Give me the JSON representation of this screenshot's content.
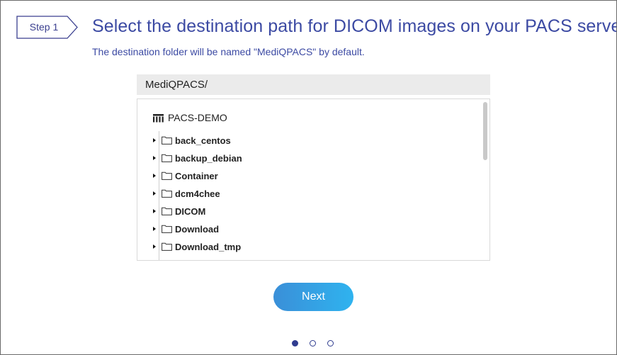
{
  "step": {
    "label": "Step 1"
  },
  "header": {
    "title": "Select the destination path for DICOM images on your PACS server.",
    "subtitle": "The destination folder will be named \"MediQPACS\" by default."
  },
  "path_bar": {
    "value": "MediQPACS/"
  },
  "tree": {
    "root": {
      "label": "PACS-DEMO",
      "icon": "server-icon"
    },
    "items": [
      {
        "label": "back_centos",
        "icon": "folder-icon"
      },
      {
        "label": "backup_debian",
        "icon": "folder-icon"
      },
      {
        "label": "Container",
        "icon": "folder-icon"
      },
      {
        "label": "dcm4chee",
        "icon": "folder-icon"
      },
      {
        "label": "DICOM",
        "icon": "folder-icon"
      },
      {
        "label": "Download",
        "icon": "folder-icon"
      },
      {
        "label": "Download_tmp",
        "icon": "folder-icon"
      }
    ]
  },
  "actions": {
    "next_label": "Next"
  },
  "pager": {
    "current": 1,
    "total": 3
  },
  "colors": {
    "accent": "#3c4aa3",
    "button_start": "#3a8fd8",
    "button_end": "#2fb3ef"
  }
}
